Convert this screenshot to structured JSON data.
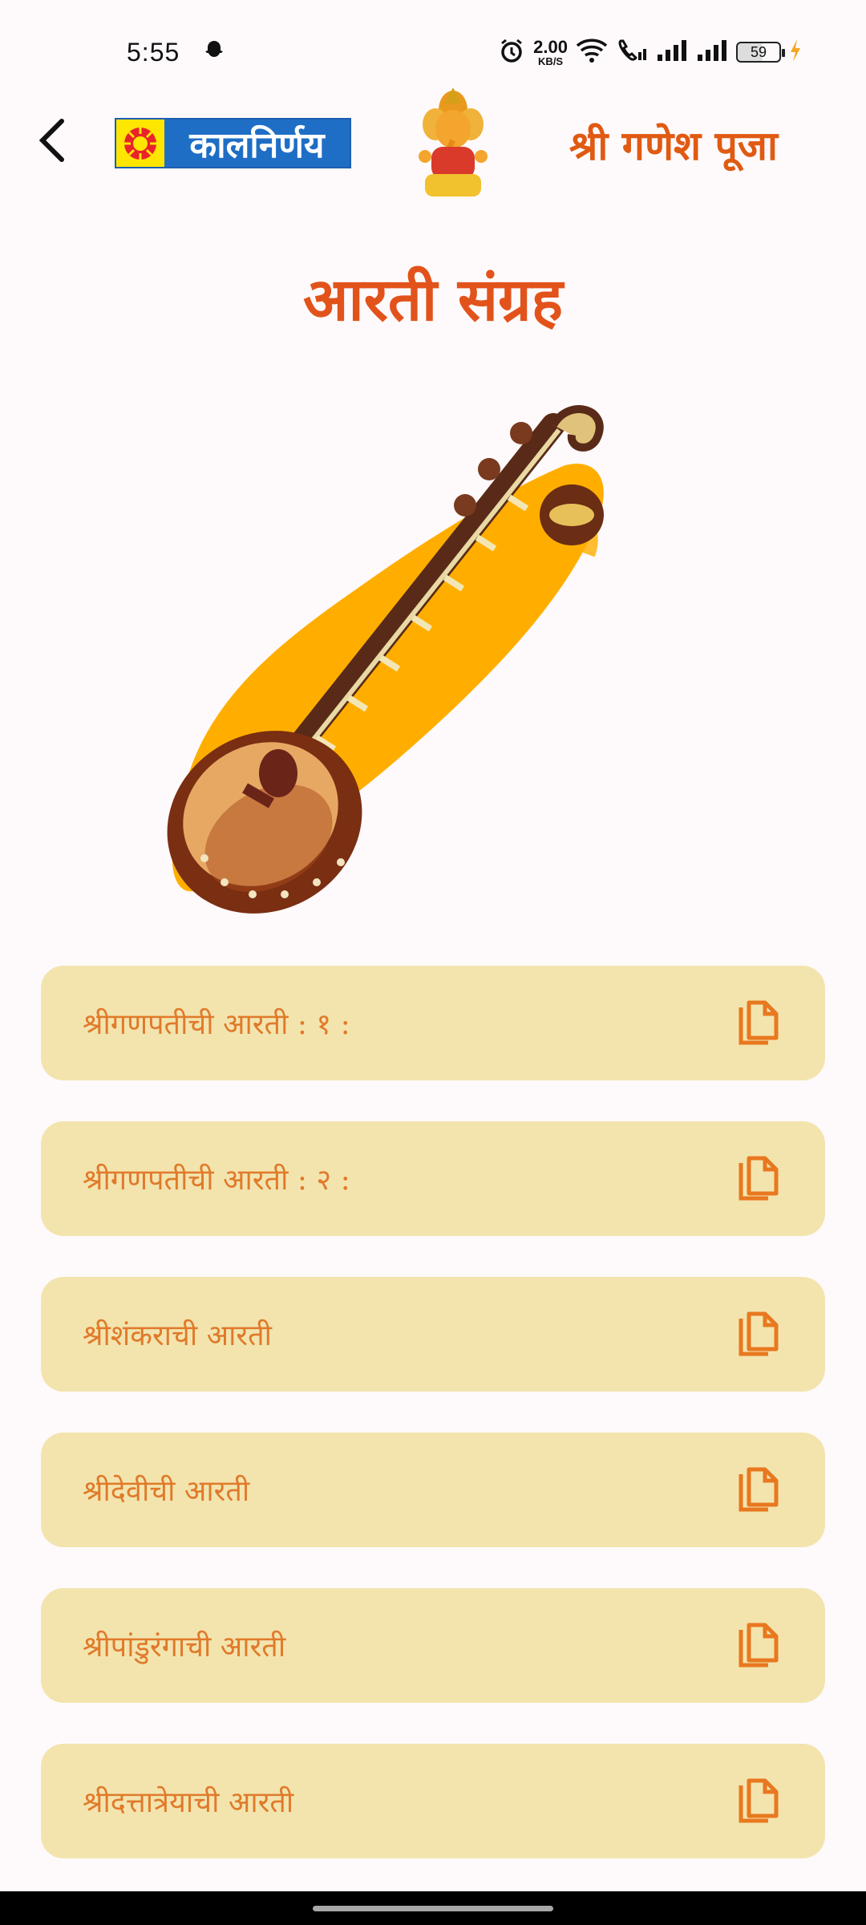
{
  "status_bar": {
    "time": "5:55",
    "net_speed_value": "2.00",
    "net_speed_unit": "KB/S",
    "battery": "59",
    "icons": [
      "snapchat-ghost-icon",
      "alarm-icon",
      "wifi-icon",
      "wifi-call-icon",
      "signal-icon",
      "signal-icon",
      "battery-icon",
      "charging-icon"
    ]
  },
  "header": {
    "brand_logo_text": "कालनिर्णय",
    "title": "श्री गणेश पूजा"
  },
  "page": {
    "title": "आरती संग्रह"
  },
  "aarti_list": [
    {
      "label": "श्रीगणपतीची आरती : १ :"
    },
    {
      "label": "श्रीगणपतीची आरती : २ :"
    },
    {
      "label": "श्रीशंकराची आरती"
    },
    {
      "label": "श्रीदेवीची आरती"
    },
    {
      "label": "श्रीपांडुरंगाची आरती"
    },
    {
      "label": "श्रीदत्तात्रेयाची आरती"
    }
  ],
  "colors": {
    "accent": "#E2531B",
    "card_bg": "#F3E4AE",
    "card_text": "#E07A2A",
    "icon": "#E8781F",
    "brush": "#FFAE00"
  }
}
